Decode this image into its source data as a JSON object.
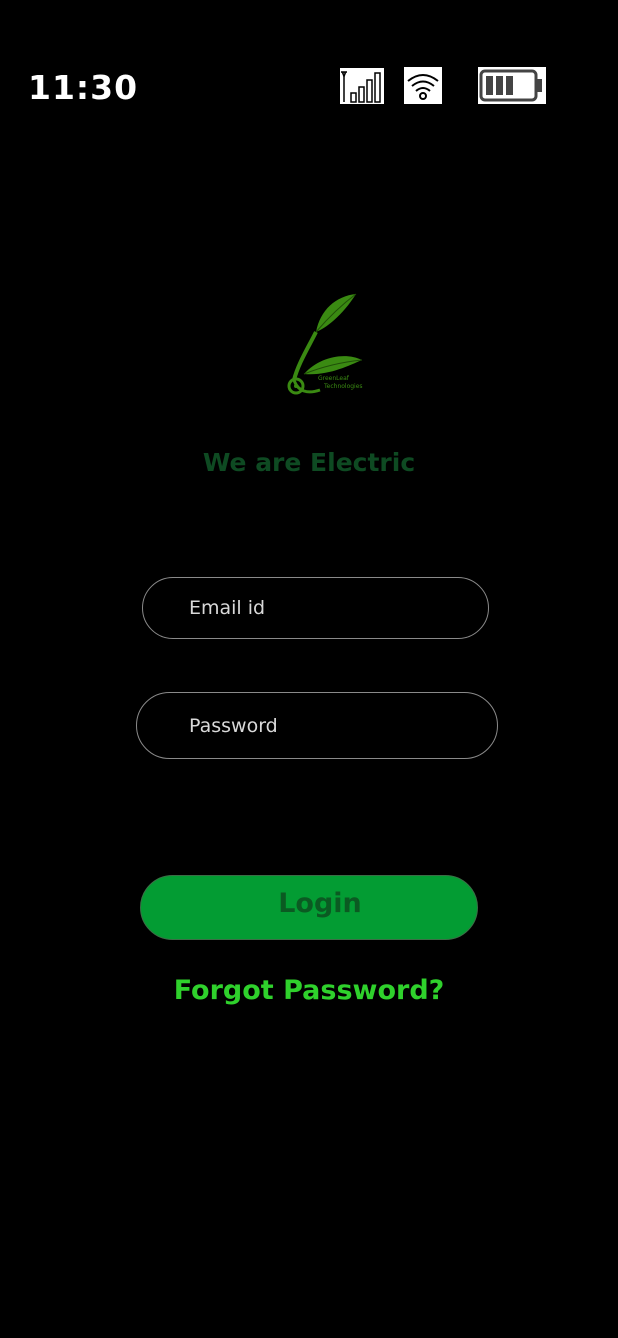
{
  "status_bar": {
    "time": "11:30",
    "signal_icon": "signal-bars-icon",
    "wifi_icon": "wifi-icon",
    "battery_icon": "battery-icon"
  },
  "brand": {
    "logo_icon": "leaf-plug-logo",
    "logo_text_line1": "GreenLeaf",
    "logo_text_line2": "Technologies",
    "tagline": "We are Electric"
  },
  "form": {
    "email_placeholder": "Email id",
    "password_placeholder": "Password",
    "login_label": "Login",
    "forgot_label": "Forgot Password?"
  },
  "colors": {
    "background": "#000000",
    "brand_green": "#3a8a12",
    "tagline_green": "#0e4a22",
    "button_green": "#039c33",
    "link_green": "#2fd12c"
  }
}
